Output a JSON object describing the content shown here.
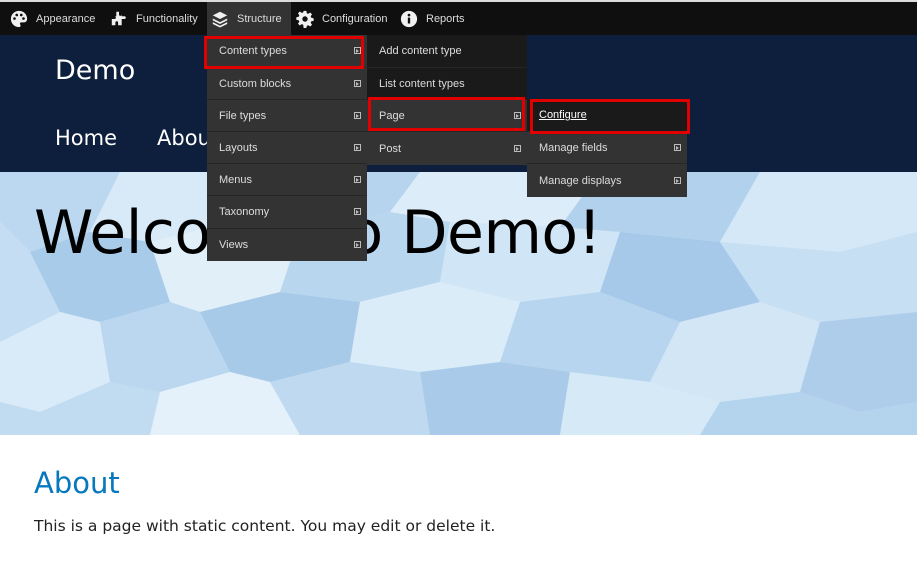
{
  "toolbar": {
    "items": [
      {
        "label": "Appearance",
        "icon": "palette-icon"
      },
      {
        "label": "Functionality",
        "icon": "puzzle-icon"
      },
      {
        "label": "Structure",
        "icon": "layers-icon"
      },
      {
        "label": "Configuration",
        "icon": "gear-icon"
      },
      {
        "label": "Reports",
        "icon": "info-icon"
      }
    ]
  },
  "site": {
    "name": "Demo",
    "nav": [
      "Home",
      "About"
    ]
  },
  "hero": {
    "title": "Welcome to Demo!"
  },
  "content": {
    "heading": "About",
    "body": "This is a page with static content. You may edit or delete it."
  },
  "menus": {
    "structure": [
      "Content types",
      "Custom blocks",
      "File types",
      "Layouts",
      "Menus",
      "Taxonomy",
      "Views"
    ],
    "content_types": [
      "Add content type",
      "List content types",
      "Page",
      "Post"
    ],
    "page": [
      "Configure",
      "Manage fields",
      "Manage displays"
    ]
  },
  "colors": {
    "toolbar_bg": "#0f0f0f",
    "menu_bg": "#333333",
    "header_bg": "#0d1f3c",
    "highlight": "#e00000",
    "heading_blue": "#0678be"
  }
}
